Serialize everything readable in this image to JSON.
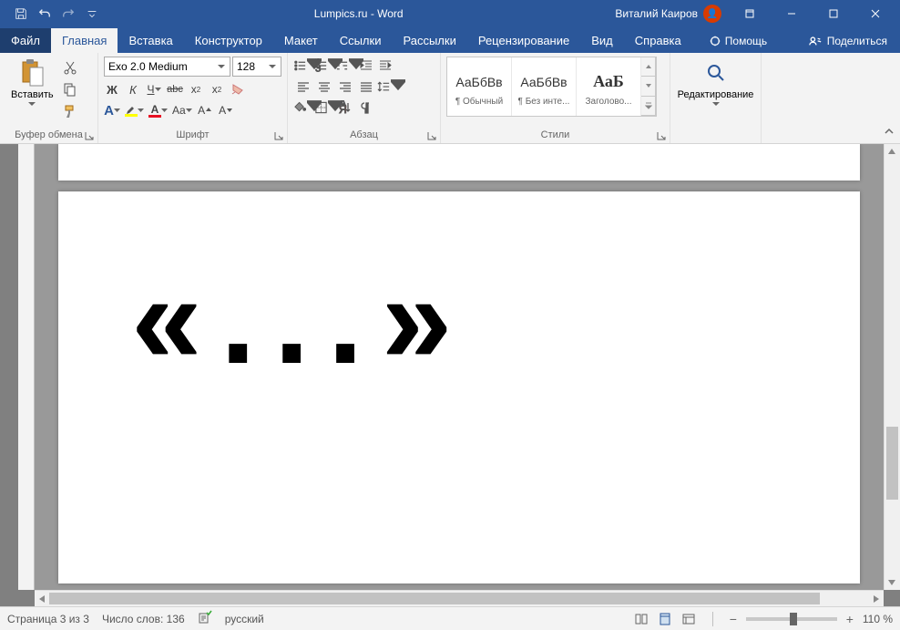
{
  "title": "Lumpics.ru - Word",
  "user": "Виталий Каиров",
  "tabs": {
    "file": "Файл",
    "home": "Главная",
    "insert": "Вставка",
    "design": "Конструктор",
    "layout": "Макет",
    "references": "Ссылки",
    "mailings": "Рассылки",
    "review": "Рецензирование",
    "view": "Вид",
    "help": "Справка",
    "tell": "Помощь",
    "share": "Поделиться"
  },
  "groups": {
    "clipboard": "Буфер обмена",
    "font": "Шрифт",
    "paragraph": "Абзац",
    "styles": "Стили",
    "editing": "Редактирование"
  },
  "clipboard": {
    "paste": "Вставить"
  },
  "font": {
    "name": "Exo 2.0 Medium",
    "size": "128",
    "bold": "Ж",
    "italic": "К",
    "underline": "Ч",
    "strike": "abc",
    "sub": "x",
    "sup": "x",
    "aa": "Aa",
    "grow": "A",
    "shrink": "A"
  },
  "styles": {
    "s1": {
      "preview": "АаБбВв",
      "name": "¶ Обычный"
    },
    "s2": {
      "preview": "АаБбВв",
      "name": "¶ Без инте..."
    },
    "s3": {
      "preview": "АаБ",
      "name": "Заголово..."
    }
  },
  "document": {
    "content": "«...»"
  },
  "status": {
    "page": "Страница 3 из 3",
    "words": "Число слов: 136",
    "lang": "русский",
    "zoom": "110 %"
  }
}
